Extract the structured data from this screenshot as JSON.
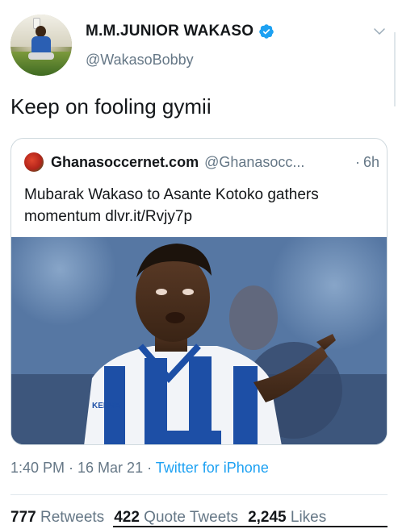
{
  "tweet": {
    "display_name": "M.M.JUNIOR WAKASO",
    "handle": "@WakasoBobby",
    "text": "Keep on fooling gymii",
    "timestamp": "1:40 PM · 16 Mar 21 ·",
    "source": "Twitter for iPhone"
  },
  "quoted": {
    "display_name": "Ghanasoccernet.com",
    "handle": "@Ghanasocc...",
    "separator": "·",
    "time": "6h",
    "text": "Mubarak Wakaso to Asante Kotoko gathers momentum dlvr.it/Rvjy7p"
  },
  "stats": {
    "retweets_count": "777",
    "retweets_label": "Retweets",
    "quotes_count": "422",
    "quotes_label": "Quote Tweets",
    "likes_count": "2,245",
    "likes_label": "Likes"
  },
  "icons": {
    "verified": "verified-badge-icon",
    "menu": "chevron-down-icon"
  },
  "colors": {
    "accent": "#1da1f2",
    "secondary_text": "#657786",
    "primary_text": "#14171a"
  }
}
